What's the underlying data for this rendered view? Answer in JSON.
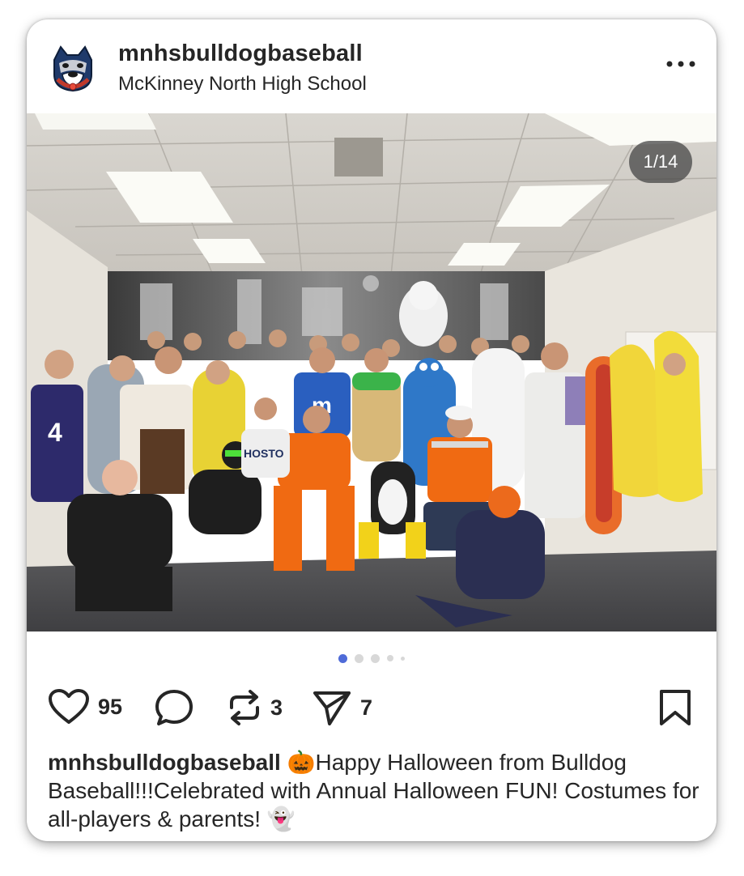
{
  "post": {
    "username": "mnhsbulldogbaseball",
    "location": "McKinney North High School",
    "image_counter": "1/14",
    "carousel_dots": 5,
    "carousel_active_index": 0,
    "image_description_alt": "Group photo of baseball team members in Halloween costumes",
    "actions": {
      "likes": "95",
      "reposts": "3",
      "shares": "7"
    },
    "caption": {
      "username": "mnhsbulldogbaseball",
      "emoji_start": "🎃",
      "text": "Happy Halloween from Bulldog Baseball!!!Celebrated with Annual Halloween FUN! Costumes for all-players & parents!",
      "emoji_end": "👻"
    }
  },
  "icons": {
    "avatar": "bulldog-logo-icon",
    "more": "more-horizontal-icon",
    "like": "heart-icon",
    "comment": "comment-bubble-icon",
    "repost": "repost-icon",
    "share": "send-icon",
    "save": "bookmark-icon"
  },
  "colors": {
    "active_dot": "#4f6bd8",
    "text": "#262626",
    "counter_bg": "#464646"
  }
}
